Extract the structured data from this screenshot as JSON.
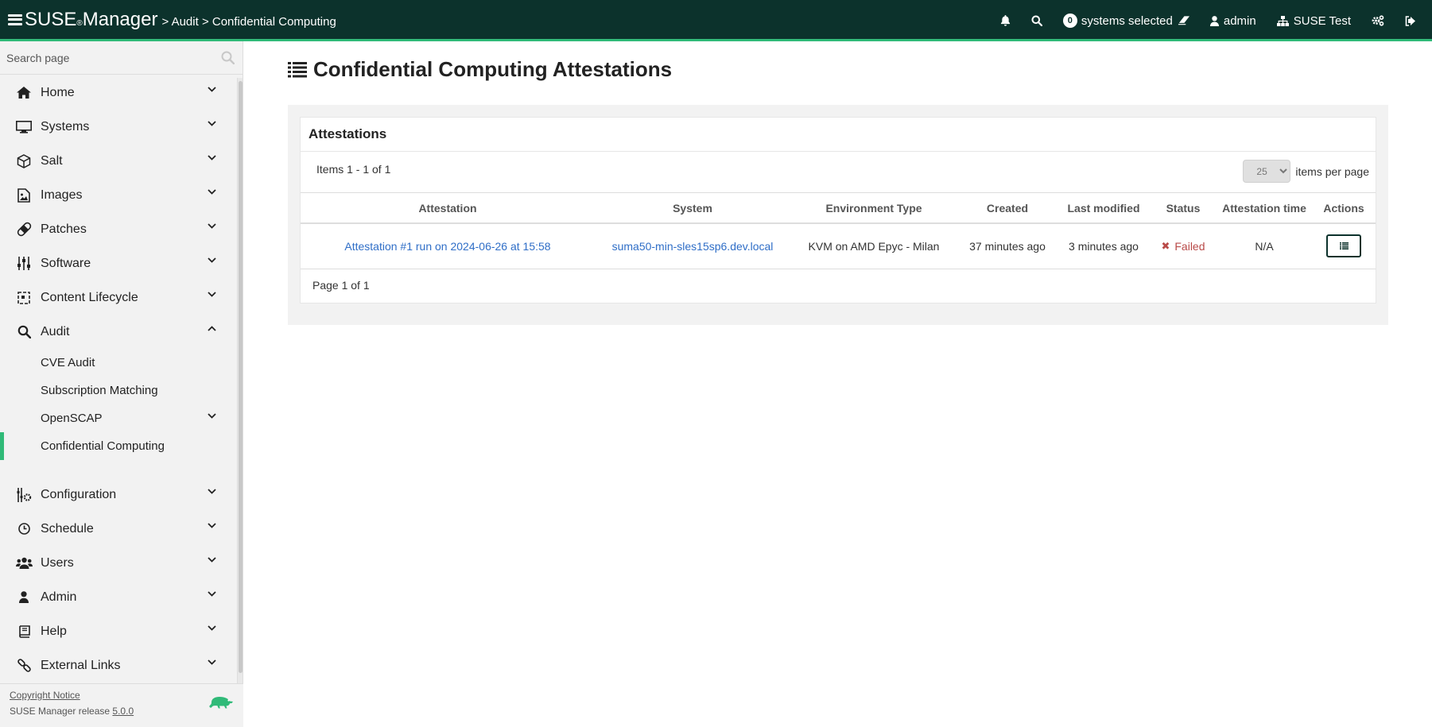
{
  "header": {
    "brand": "SUSE",
    "brand_reg": "®",
    "brand_product": "Manager",
    "breadcrumb": [
      {
        "label": "> Audit"
      },
      {
        "label": "> Confidential Computing"
      }
    ],
    "systems_selected_count": "0",
    "systems_selected_label": "systems selected",
    "user": "admin",
    "org": "SUSE Test"
  },
  "sidebar": {
    "search_placeholder": "Search page",
    "items": [
      {
        "label": "Home",
        "icon": "home-icon"
      },
      {
        "label": "Systems",
        "icon": "desktop-icon"
      },
      {
        "label": "Salt",
        "icon": "cubes-icon"
      },
      {
        "label": "Images",
        "icon": "file-image-icon"
      },
      {
        "label": "Patches",
        "icon": "bandage-icon"
      },
      {
        "label": "Software",
        "icon": "sliders-icon"
      },
      {
        "label": "Content Lifecycle",
        "icon": "lifecycle-icon"
      },
      {
        "label": "Audit",
        "icon": "search-icon"
      },
      {
        "label": "Configuration",
        "icon": "config-icon"
      },
      {
        "label": "Schedule",
        "icon": "clock-icon"
      },
      {
        "label": "Users",
        "icon": "users-icon"
      },
      {
        "label": "Admin",
        "icon": "user-icon"
      },
      {
        "label": "Help",
        "icon": "book-icon"
      },
      {
        "label": "External Links",
        "icon": "link-icon"
      }
    ],
    "audit_sub": [
      {
        "label": "CVE Audit"
      },
      {
        "label": "Subscription Matching"
      },
      {
        "label": "OpenSCAP"
      },
      {
        "label": "Confidential Computing"
      }
    ],
    "footer": {
      "copyright": "Copyright Notice",
      "release_prefix": "SUSE Manager release",
      "release_version": "5.0.0"
    }
  },
  "main": {
    "title": "Confidential Computing Attestations",
    "panel_title": "Attestations",
    "items_count": "Items 1 - 1 of 1",
    "per_page_value": "25",
    "per_page_label": "items per page",
    "columns": [
      "Attestation",
      "System",
      "Environment Type",
      "Created",
      "Last modified",
      "Status",
      "Attestation time",
      "Actions"
    ],
    "rows": [
      {
        "attestation": "Attestation #1 run on 2024-06-26 at 15:58",
        "system": "suma50-min-sles15sp6.dev.local",
        "environment": "KVM on AMD Epyc - Milan",
        "created": "37 minutes ago",
        "modified": "3 minutes ago",
        "status": "Failed",
        "attestation_time": "N/A"
      }
    ],
    "page_info": "Page 1 of 1"
  },
  "colors": {
    "header_bg": "#0c322c",
    "accent": "#30ba78",
    "link": "#2f6ec7",
    "failed": "#b94a48"
  }
}
